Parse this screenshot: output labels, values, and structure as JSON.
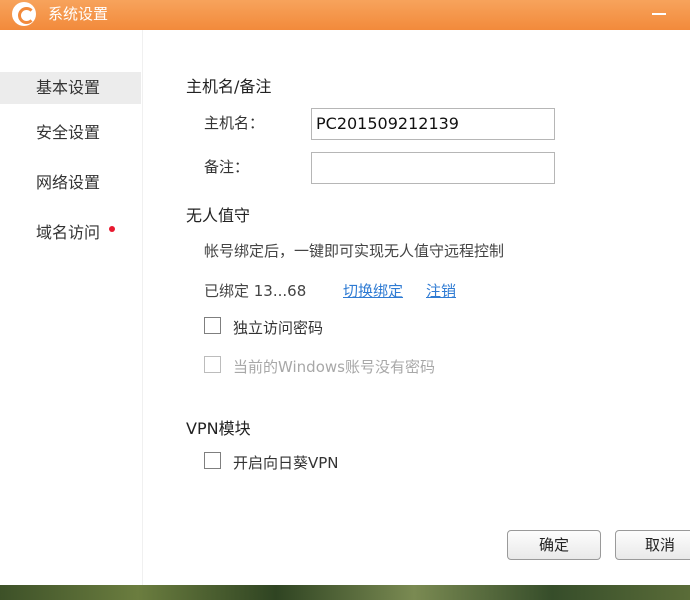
{
  "window": {
    "title": "系统设置"
  },
  "sidebar": {
    "items": [
      {
        "label": "基本设置",
        "active": true
      },
      {
        "label": "安全设置"
      },
      {
        "label": "网络设置"
      },
      {
        "label": "域名访问",
        "badge": "red-dot"
      }
    ]
  },
  "host": {
    "section_title": "主机名/备注",
    "hostname_label": "主机名：",
    "hostname_value": "PC201509212139",
    "note_label": "备注：",
    "note_value": ""
  },
  "unattended": {
    "section_title": "无人值守",
    "description": "帐号绑定后，一键即可实现无人值守远程控制",
    "bound_text": "已绑定 13...68",
    "switch_link": "切换绑定",
    "logout_link": "注销",
    "option1": "独立访问密码",
    "option2": "当前的Windows账号没有密码"
  },
  "vpn": {
    "section_title": "VPN模块",
    "option": "开启向日葵VPN"
  },
  "footer": {
    "ok_label": "确定",
    "cancel_label": "取消"
  },
  "colors": {
    "titlebar": "#f28a3b",
    "link": "#2f7bd3",
    "badge": "#e8192f"
  }
}
